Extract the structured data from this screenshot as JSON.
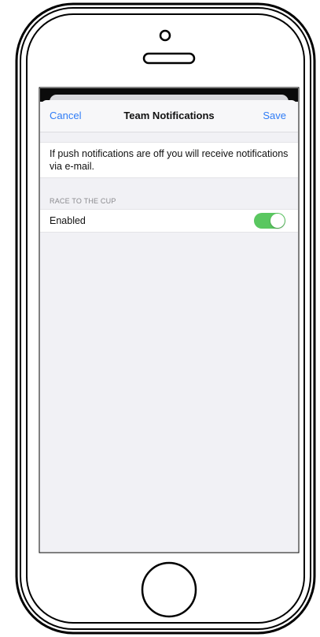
{
  "navbar": {
    "cancel_label": "Cancel",
    "title": "Team Notifications",
    "save_label": "Save"
  },
  "info": {
    "text": "If push notifications are off you will receive notifications via e-mail."
  },
  "section": {
    "header": "RACE TO THE CUP",
    "toggle_label": "Enabled",
    "toggle_on": true
  },
  "colors": {
    "accent": "#2f7cf6",
    "toggle_on": "#5ac760",
    "background": "#f1f1f5"
  },
  "icons": {
    "camera": "front-camera-icon",
    "speaker": "earpiece-speaker-icon",
    "home": "home-button-icon"
  }
}
